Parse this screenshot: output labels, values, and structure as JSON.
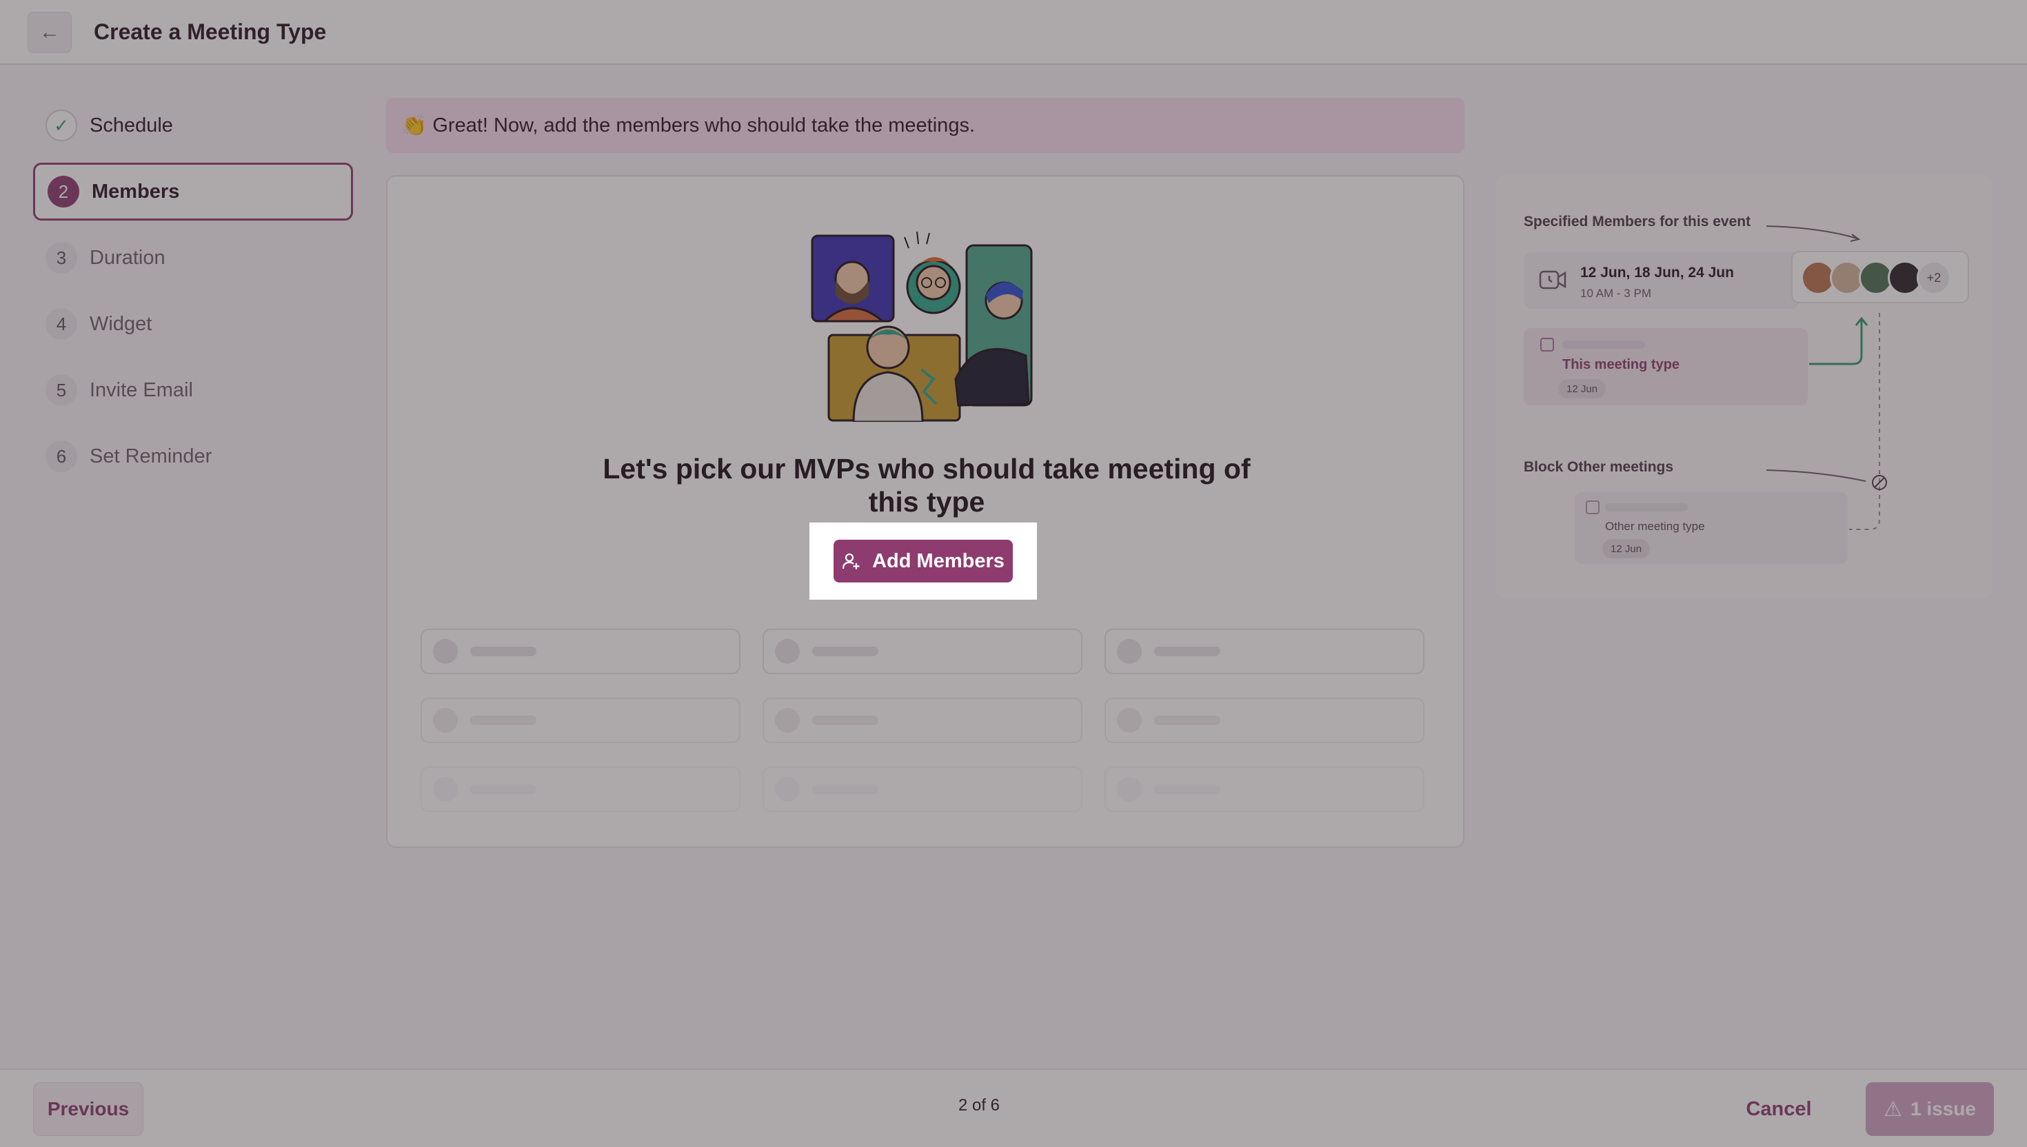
{
  "header": {
    "title": "Create a Meeting Type",
    "back_icon": "arrow-left-icon"
  },
  "steps": [
    {
      "number": "",
      "label": "Schedule",
      "state": "done",
      "icon": "check-icon"
    },
    {
      "number": "2",
      "label": "Members",
      "state": "active"
    },
    {
      "number": "3",
      "label": "Duration",
      "state": "pending"
    },
    {
      "number": "4",
      "label": "Widget",
      "state": "pending"
    },
    {
      "number": "5",
      "label": "Invite Email",
      "state": "pending"
    },
    {
      "number": "6",
      "label": "Set Reminder",
      "state": "pending"
    }
  ],
  "banner": {
    "emoji": "👏",
    "text": "Great! Now, add the members who should take the meetings."
  },
  "main": {
    "headline": "Let's pick our MVPs who should take meeting of this type",
    "add_button_label": "Add Members",
    "add_button_icon": "add-person-icon"
  },
  "preview": {
    "specified_title": "Specified Members for this event",
    "dates": "12 Jun, 18 Jun, 24 Jun",
    "time": "10 AM - 3 PM",
    "extra_members": "+2",
    "this_meeting_label": "This meeting type",
    "this_meeting_chip": "12 Jun",
    "block_title": "Block Other meetings",
    "other_meeting_label": "Other meeting type",
    "other_meeting_chip": "12 Jun"
  },
  "footer": {
    "previous_label": "Previous",
    "progress": "2 of 6",
    "cancel_label": "Cancel",
    "issue_label": "1 issue",
    "issue_icon": "warning-triangle-icon"
  },
  "colors": {
    "brand": "#8e3b6f",
    "banner": "#f8dbee",
    "overlay": "rgba(60,50,55,0.42)"
  }
}
